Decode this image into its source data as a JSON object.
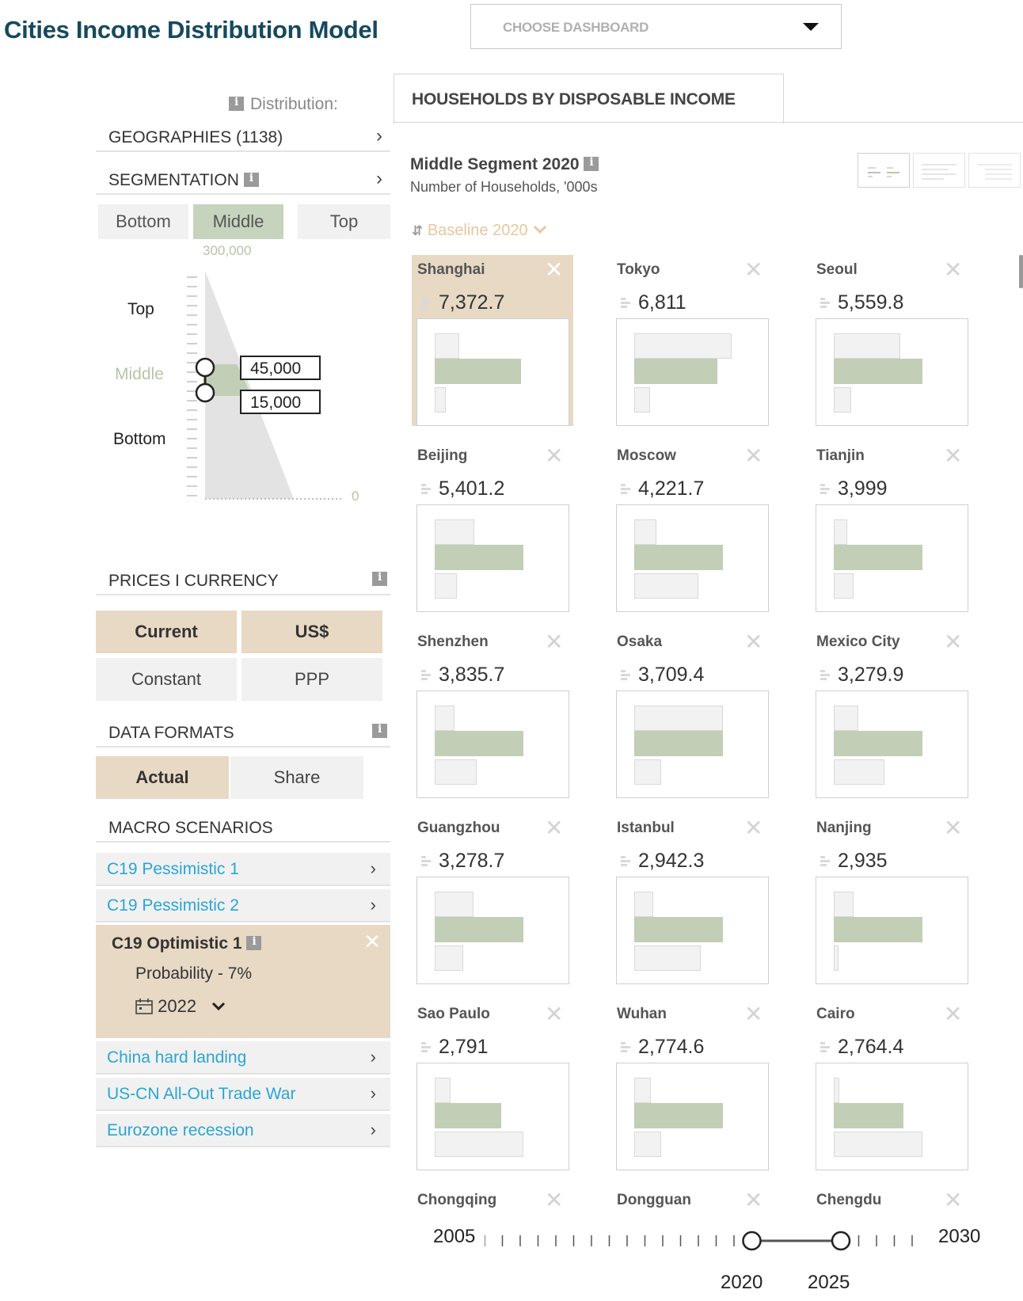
{
  "header": {
    "title": "Cities Income Distribution Model",
    "dashboard_placeholder": "CHOOSE DASHBOARD"
  },
  "left": {
    "distribution_label": "Distribution:",
    "geographies": "GEOGRAPHIES (1138)",
    "segmentation": "SEGMENTATION",
    "segment_tabs": [
      "Bottom",
      "Middle",
      "Top"
    ],
    "active_segment": "Middle",
    "dist_chart": {
      "axis_max": "300,000",
      "axis_min": "0",
      "labels": [
        "Top",
        "Middle",
        "Bottom"
      ],
      "upper_threshold": "45,000",
      "lower_threshold": "15,000"
    },
    "prices_currency": "PRICES I CURRENCY",
    "price_buttons": [
      "Current",
      "Constant"
    ],
    "currency_buttons": [
      "US$",
      "PPP"
    ],
    "data_formats": "DATA FORMATS",
    "format_buttons": [
      "Actual",
      "Share"
    ],
    "macro_scenarios": "MACRO SCENARIOS",
    "scenarios_top": [
      "C19 Pessimistic 1",
      "C19 Pessimistic 2"
    ],
    "active_scenario": {
      "name": "C19 Optimistic 1",
      "probability": "Probability - 7%",
      "year": "2022"
    },
    "scenarios_bottom": [
      "China hard landing",
      "US-CN All-Out Trade War",
      "Eurozone recession"
    ]
  },
  "main": {
    "tab": "HOUSEHOLDS BY DISPOSABLE INCOME",
    "segment_title": "Middle Segment 2020",
    "segment_subtitle": "Number of Households, '000s",
    "sort_label": "Baseline 2020",
    "colors": {
      "middle": "#c2ceb5",
      "selected": "#e7d9c4",
      "accent": "#2aa6d4",
      "title": "#16495e"
    },
    "cities": [
      {
        "name": "Shanghai",
        "value": "7,372.7",
        "top": 0.22,
        "mid": 0.78,
        "bot": 0.1,
        "selected": true
      },
      {
        "name": "Tokyo",
        "value": "6,811",
        "top": 0.88,
        "mid": 0.75,
        "bot": 0.14
      },
      {
        "name": "Seoul",
        "value": "5,559.8",
        "top": 0.6,
        "mid": 0.8,
        "bot": 0.16
      },
      {
        "name": "Beijing",
        "value": "5,401.2",
        "top": 0.36,
        "mid": 0.8,
        "bot": 0.2
      },
      {
        "name": "Moscow",
        "value": "4,221.7",
        "top": 0.2,
        "mid": 0.8,
        "bot": 0.58
      },
      {
        "name": "Tianjin",
        "value": "3,999",
        "top": 0.12,
        "mid": 0.8,
        "bot": 0.18
      },
      {
        "name": "Shenzhen",
        "value": "3,835.7",
        "top": 0.18,
        "mid": 0.8,
        "bot": 0.38
      },
      {
        "name": "Osaka",
        "value": "3,709.4",
        "top": 0.8,
        "mid": 0.8,
        "bot": 0.24
      },
      {
        "name": "Mexico City",
        "value": "3,279.9",
        "top": 0.22,
        "mid": 0.8,
        "bot": 0.46
      },
      {
        "name": "Guangzhou",
        "value": "3,278.7",
        "top": 0.35,
        "mid": 0.8,
        "bot": 0.26
      },
      {
        "name": "Istanbul",
        "value": "2,942.3",
        "top": 0.17,
        "mid": 0.8,
        "bot": 0.6
      },
      {
        "name": "Nanjing",
        "value": "2,935",
        "top": 0.18,
        "mid": 0.8,
        "bot": 0.04
      },
      {
        "name": "Sao Paulo",
        "value": "2,791",
        "top": 0.14,
        "mid": 0.6,
        "bot": 0.8
      },
      {
        "name": "Wuhan",
        "value": "2,774.6",
        "top": 0.15,
        "mid": 0.8,
        "bot": 0.24
      },
      {
        "name": "Cairo",
        "value": "2,764.4",
        "top": 0.05,
        "mid": 0.63,
        "bot": 0.8
      },
      {
        "name": "Chongqing",
        "value": "",
        "top": 0,
        "mid": 0,
        "bot": 0
      },
      {
        "name": "Dongguan",
        "value": "",
        "top": 0,
        "mid": 0,
        "bot": 0
      },
      {
        "name": "Chengdu",
        "value": "",
        "top": 0,
        "mid": 0,
        "bot": 0
      }
    ]
  },
  "timeline": {
    "start": "2005",
    "end": "2030",
    "range_start": "2020",
    "range_end": "2025"
  }
}
